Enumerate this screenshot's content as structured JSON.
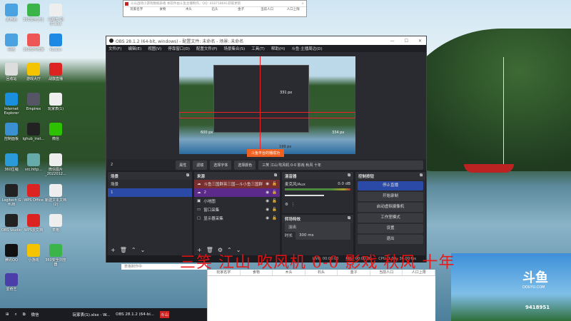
{
  "desktop_icons": [
    {
      "label": "此电脑",
      "color": "#4aa3e0"
    },
    {
      "label": "360安全卫士",
      "color": "#3bb54a"
    },
    {
      "label": "兴趣表 副本.xlsx",
      "color": "#eee"
    },
    {
      "label": "网络",
      "color": "#4aa3e0"
    },
    {
      "label": "360软件管家",
      "color": "#e55"
    },
    {
      "label": "Kuaiso",
      "color": "#1e88e5"
    },
    {
      "label": "回收站",
      "color": "#ddd"
    },
    {
      "label": "游戏大厅",
      "color": "#f5c400"
    },
    {
      "label": "战旗直播",
      "color": "#d22"
    },
    {
      "label": "Internet Explorer",
      "color": "#1a8fe0"
    },
    {
      "label": "Empirex",
      "color": "#556"
    },
    {
      "label": "玩家表(1)",
      "color": "#eee"
    },
    {
      "label": "控制面板",
      "color": "#3a90d0"
    },
    {
      "label": "lghub_inst...",
      "color": "#222"
    },
    {
      "label": "微信",
      "color": "#2dc100"
    },
    {
      "label": "360压缩",
      "color": "#2a9ad8"
    },
    {
      "label": "src.http...",
      "color": "#6aa"
    },
    {
      "label": "微信图片_2022012...",
      "color": "#eee"
    },
    {
      "label": "Logitech G HUB",
      "color": "#222"
    },
    {
      "label": "WPS Office",
      "color": "#d22"
    },
    {
      "label": "新建文本文档(2)",
      "color": "#eee"
    },
    {
      "label": "OBS Studio",
      "color": "#222"
    },
    {
      "label": "WPS云文档",
      "color": "#d22"
    },
    {
      "label": "表格",
      "color": "#eee"
    },
    {
      "label": "腾讯QQ",
      "color": "#111"
    },
    {
      "label": "小游戏",
      "color": "#f5c400"
    },
    {
      "label": "360安全浏览器",
      "color": "#3bb54a"
    },
    {
      "label": "爱奇艺",
      "color": "#4b3ea8"
    }
  ],
  "top_window": {
    "title": "斗山战场小游戏数据表格  本软件由斗鱼主播制作，QQ: 418718691获取更新",
    "columns": [
      "玩家名字",
      "食物",
      "木头",
      "石头",
      "金子",
      "当前人口",
      "人口上限"
    ],
    "close": "×"
  },
  "obs": {
    "title": "OBS 28.1.2 (64-bit, windows) - 配置文件: 未命名 - 场景: 未命名",
    "window_controls": [
      "—",
      "☐",
      "✕"
    ],
    "menu": [
      "文件(F)",
      "编辑(E)",
      "视图(V)",
      "停靠窗口(D)",
      "配置文件(P)",
      "场景集合(S)",
      "工具(T)",
      "帮助(H)",
      "斗鱼·主播周边(D)"
    ],
    "preview": {
      "label_top": "331 px",
      "label_left": "600 px",
      "label_right": "334 px",
      "label_bottom": "199 px",
      "toast": "斗鱼平台的播成功"
    },
    "toolbar": {
      "source_name": "2",
      "properties": "属性",
      "filters": "滤镜",
      "select_font": "选择字体",
      "select_color": "选择颜色",
      "text_value": "三笑 江山 吹风机 0-0 影戏 秋风 十年"
    },
    "scenes": {
      "title": "场景",
      "items": [
        "场景",
        "1"
      ]
    },
    "sources": {
      "title": "来源",
      "items": [
        "斗鱼三国群英三国—斗小鱼三国群",
        "2",
        "小地图",
        "窗口采集",
        "显示器采集"
      ]
    },
    "mixer": {
      "title": "混音器",
      "channel": "麦克风/Aux",
      "db": "0.0 dB"
    },
    "transitions": {
      "title": "转场特效",
      "type": "淡出",
      "duration_label": "时长",
      "duration": "300 ms"
    },
    "controls": {
      "title": "控制按钮",
      "buttons": [
        "停止直播",
        "开始录制",
        "启动虚拟摄像机",
        "工作室模式",
        "设置",
        "退出"
      ]
    },
    "status": {
      "live": "LIVE: 00:00:00",
      "rec": "REC: 00:00:00",
      "cpu": "CPU: 2.0%, 30.00 fps"
    }
  },
  "overlay_text": "三笑 江山 吹风机 0-0 影戏 秋风 十年",
  "spreadsheet": {
    "toolbar_label": "表格制作中",
    "columns": [
      "玩家名字",
      "食物",
      "木头",
      "石头",
      "金子",
      "当前人口",
      "人口上限"
    ]
  },
  "douyu": {
    "logo": "斗鱼",
    "domain": "DOUYU.COM",
    "room": "9418951"
  },
  "taskbar": {
    "items": [
      "微信",
      "玩家表(1).xlsx - W...",
      "OBS 28.1.2 (64-bi...",
      "斗山"
    ]
  }
}
